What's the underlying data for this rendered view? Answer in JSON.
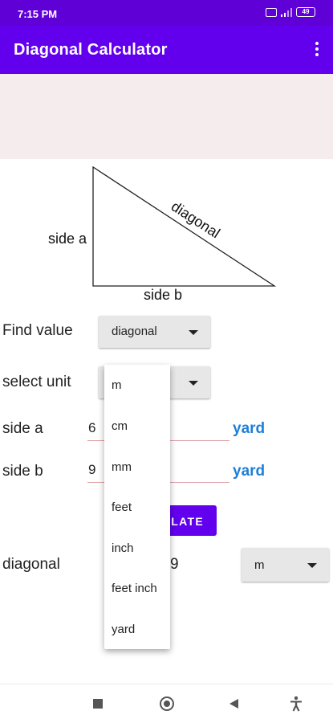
{
  "status_bar": {
    "time": "7:15 PM",
    "icons": [
      "sim-card-icon",
      "signal-icon",
      "battery-icon"
    ],
    "battery": "49"
  },
  "app_bar": {
    "title": "Diagonal Calculator",
    "menu_icon": "more-vertical-icon"
  },
  "figure": {
    "side_a": "side a",
    "side_b": "side b",
    "diagonal": "diagonal"
  },
  "form": {
    "find_value": {
      "label": "Find value",
      "selected": "diagonal"
    },
    "select_unit": {
      "label": "select unit"
    },
    "side_a": {
      "label": "side a",
      "value": "6",
      "unit": "yard"
    },
    "side_b": {
      "label": "side b",
      "value": "9",
      "unit": "yard"
    },
    "calculate_button": "LATE",
    "result": {
      "label": "diagonal",
      "value": "9",
      "unit": "m"
    }
  },
  "unit_dropdown": {
    "options": [
      "m",
      "cm",
      "mm",
      "feet",
      "inch",
      "feet inch",
      "yard"
    ]
  },
  "nav_bar": {
    "icons": [
      "recents-icon",
      "home-icon",
      "back-icon",
      "accessibility-icon"
    ]
  },
  "colors": {
    "status_bar": "#5f00d6",
    "app_bar": "#6200ee",
    "accent_text": "#1e7fd8",
    "ad_banner": "#f5ecee",
    "input_underline": "#e0a0a8"
  }
}
